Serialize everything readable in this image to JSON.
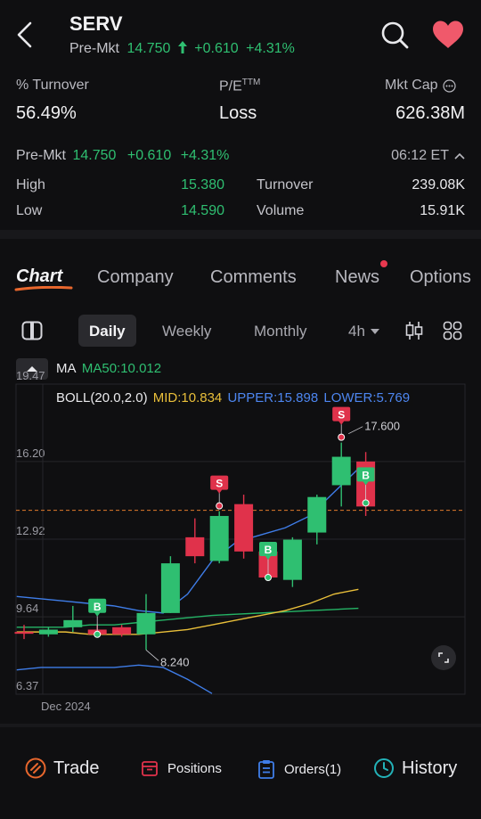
{
  "header": {
    "ticker": "SERV",
    "premkt_label": "Pre-Mkt",
    "premkt_price": "14.750",
    "premkt_change": "+0.610",
    "premkt_pct": "+4.31%"
  },
  "stats": {
    "turnover_label": "% Turnover",
    "turnover_value": "56.49%",
    "pe_label": "P/E",
    "pe_sup": "TTM",
    "pe_value": "Loss",
    "mktcap_label": "Mkt Cap",
    "mktcap_value": "626.38M"
  },
  "quote": {
    "premkt_label": "Pre-Mkt",
    "premkt_price": "14.750",
    "premkt_change": "+0.610",
    "premkt_pct": "+4.31%",
    "time": "06:12 ET",
    "high_label": "High",
    "high_value": "15.380",
    "low_label": "Low",
    "low_value": "14.590",
    "turnover_label": "Turnover",
    "turnover_value": "239.08K",
    "volume_label": "Volume",
    "volume_value": "15.91K"
  },
  "tabs": [
    "Chart",
    "Company",
    "Comments",
    "News",
    "Options"
  ],
  "periods": {
    "daily": "Daily",
    "weekly": "Weekly",
    "monthly": "Monthly",
    "interval": "4h"
  },
  "indicators": {
    "ma_label": "MA",
    "ma50": "MA50:10.012",
    "boll": "BOLL(20.0,2.0)",
    "mid": "MID:10.834",
    "upper": "UPPER:15.898",
    "lower": "LOWER:5.769"
  },
  "chart_data": {
    "type": "candlestick",
    "y_ticks": [
      "19.47",
      "16.20",
      "12.92",
      "9.64",
      "6.37"
    ],
    "x_label": "Dec 2024",
    "ylim": [
      6.37,
      19.47
    ],
    "candles": [
      {
        "open": 9.0,
        "close": 9.0,
        "high": 9.3,
        "low": 8.7,
        "color": "red"
      },
      {
        "open": 8.9,
        "close": 9.1,
        "high": 9.2,
        "low": 8.8,
        "color": "green"
      },
      {
        "open": 9.2,
        "close": 9.5,
        "high": 10.1,
        "low": 9.0,
        "color": "green"
      },
      {
        "open": 9.1,
        "close": 8.9,
        "high": 9.3,
        "low": 8.8,
        "color": "red"
      },
      {
        "open": 9.2,
        "close": 8.9,
        "high": 9.3,
        "low": 8.8,
        "color": "red"
      },
      {
        "open": 8.9,
        "close": 9.8,
        "high": 10.6,
        "low": 8.24,
        "color": "green"
      },
      {
        "open": 9.8,
        "close": 11.9,
        "high": 12.2,
        "low": 9.8,
        "color": "green"
      },
      {
        "open": 13.0,
        "close": 12.2,
        "high": 13.8,
        "low": 11.9,
        "color": "red"
      },
      {
        "open": 12.0,
        "close": 13.9,
        "high": 14.1,
        "low": 11.9,
        "color": "green"
      },
      {
        "open": 14.4,
        "close": 12.4,
        "high": 14.8,
        "low": 12.1,
        "color": "red"
      },
      {
        "open": 12.4,
        "close": 11.3,
        "high": 12.7,
        "low": 11.2,
        "color": "red"
      },
      {
        "open": 11.2,
        "close": 12.9,
        "high": 13.0,
        "low": 10.9,
        "color": "green"
      },
      {
        "open": 13.2,
        "close": 14.7,
        "high": 14.8,
        "low": 12.7,
        "color": "green"
      },
      {
        "open": 15.2,
        "close": 16.4,
        "high": 17.0,
        "low": 14.3,
        "color": "green"
      },
      {
        "open": 16.2,
        "close": 14.3,
        "high": 16.6,
        "low": 13.9,
        "color": "red"
      }
    ],
    "signals": [
      {
        "index": 3,
        "type": "B"
      },
      {
        "index": 8,
        "type": "S"
      },
      {
        "index": 10,
        "type": "B"
      },
      {
        "index": 13,
        "type": "S"
      },
      {
        "index": 14,
        "type": "B"
      }
    ],
    "annotations": {
      "high": "17.600",
      "low": "8.240"
    },
    "current_price": 14.14,
    "series": {
      "boll_upper": [
        10.5,
        10.4,
        10.3,
        10.2,
        10.1,
        9.9,
        9.8,
        10.6,
        12.0,
        12.8,
        13.1,
        13.4,
        13.9,
        14.9,
        15.9
      ],
      "boll_mid": [
        9.0,
        9.0,
        9.0,
        8.9,
        8.9,
        8.9,
        9.0,
        9.1,
        9.3,
        9.5,
        9.7,
        9.9,
        10.2,
        10.6,
        10.8
      ],
      "boll_lower": [
        7.4,
        7.5,
        7.5,
        7.5,
        7.5,
        7.6,
        7.5,
        7.0,
        6.4
      ],
      "ma50": [
        9.2,
        9.2,
        9.2,
        9.3,
        9.3,
        9.4,
        9.5,
        9.6,
        9.7,
        9.75,
        9.8,
        9.85,
        9.9,
        9.95,
        10.0
      ]
    }
  },
  "bottom_nav": {
    "trade": "Trade",
    "positions": "Positions",
    "orders": "Orders(1)",
    "history": "History"
  },
  "colors": {
    "up": "#2fbf71",
    "down": "#e0324b",
    "boll_upper": "#3f7de8",
    "boll_mid": "#e9bf3a",
    "ma50": "#25b566",
    "price_line": "#e07a2c"
  }
}
